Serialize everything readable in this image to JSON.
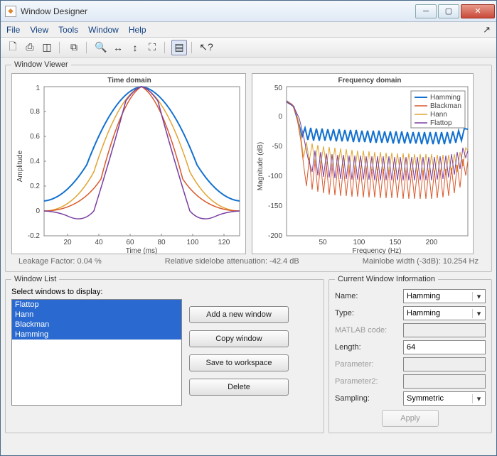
{
  "window": {
    "title": "Window Designer"
  },
  "menubar": [
    "File",
    "View",
    "Tools",
    "Window",
    "Help"
  ],
  "viewer": {
    "legend_title": "Window Viewer",
    "time_title": "Time domain",
    "time_xlabel": "Time (ms)",
    "time_ylabel": "Amplitude",
    "freq_title": "Frequency domain",
    "freq_xlabel": "Frequency (Hz)",
    "freq_ylabel": "Magnitude (dB)",
    "legend": [
      "Hamming",
      "Blackman",
      "Hann",
      "Flattop"
    ],
    "stats": {
      "leakage": "Leakage Factor: 0.04 %",
      "sidelobe": "Relative sidelobe attenuation: -42.4 dB",
      "mainlobe": "Mainlobe width (-3dB): 10.254 Hz"
    }
  },
  "chart_data": [
    {
      "type": "line",
      "title": "Time domain",
      "xlabel": "Time (ms)",
      "ylabel": "Amplitude",
      "xlim": [
        0,
        130
      ],
      "ylim": [
        -0.2,
        1
      ],
      "xticks": [
        20,
        40,
        60,
        80,
        100,
        120
      ],
      "yticks": [
        -0.2,
        0,
        0.2,
        0.4,
        0.6,
        0.8,
        1
      ],
      "series_shape": "window-function",
      "legend": [
        "Hamming",
        "Blackman",
        "Hann",
        "Flattop"
      ]
    },
    {
      "type": "line",
      "title": "Frequency domain",
      "xlabel": "Frequency (Hz)",
      "ylabel": "Magnitude (dB)",
      "xlim": [
        0,
        250
      ],
      "ylim": [
        -200,
        50
      ],
      "xticks": [
        50,
        100,
        150,
        200
      ],
      "yticks": [
        -200,
        -150,
        -100,
        -50,
        0,
        50
      ],
      "series_shape": "sidelobe-decay",
      "legend": [
        "Hamming",
        "Blackman",
        "Hann",
        "Flattop"
      ]
    }
  ],
  "window_list": {
    "legend_title": "Window List",
    "label": "Select windows to display:",
    "items": [
      "Flattop",
      "Hann",
      "Blackman",
      "Hamming"
    ],
    "buttons": {
      "add": "Add a new window",
      "copy": "Copy window",
      "save": "Save to workspace",
      "delete": "Delete"
    }
  },
  "cwi": {
    "legend_title": "Current Window Information",
    "labels": {
      "name": "Name:",
      "type": "Type:",
      "matlab": "MATLAB code:",
      "length": "Length:",
      "param": "Parameter:",
      "param2": "Parameter2:",
      "sampling": "Sampling:",
      "apply": "Apply"
    },
    "values": {
      "name": "Hamming",
      "type": "Hamming",
      "length": "64",
      "sampling": "Symmetric"
    }
  }
}
